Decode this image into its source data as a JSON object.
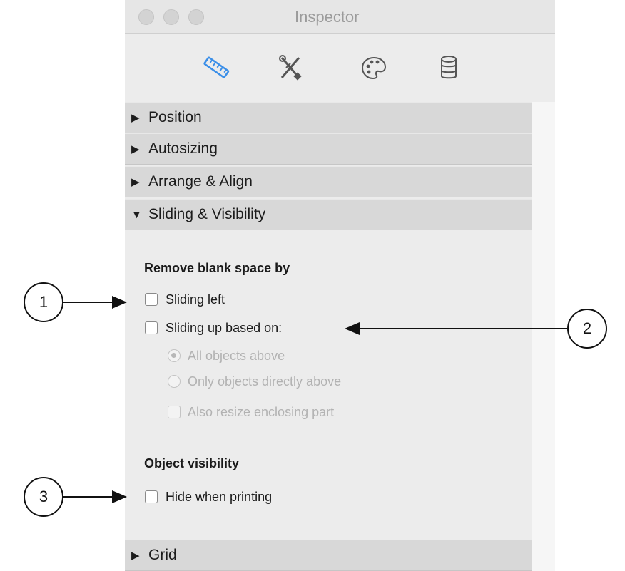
{
  "window": {
    "title": "Inspector"
  },
  "toolbar": {
    "tabs": [
      {
        "name": "position",
        "icon": "ruler-icon",
        "active": true
      },
      {
        "name": "styles",
        "icon": "tools-icon",
        "active": false
      },
      {
        "name": "appearance",
        "icon": "palette-icon",
        "active": false
      },
      {
        "name": "data",
        "icon": "database-icon",
        "active": false
      }
    ],
    "active_color": "#3b8fe8"
  },
  "sections": {
    "position": {
      "label": "Position",
      "expanded": false
    },
    "autosizing": {
      "label": "Autosizing",
      "expanded": false
    },
    "arrange": {
      "label": "Arrange & Align",
      "expanded": false
    },
    "sliding": {
      "label": "Sliding & Visibility",
      "expanded": true
    },
    "grid": {
      "label": "Grid",
      "expanded": false
    }
  },
  "sliding": {
    "remove_heading": "Remove blank space by",
    "sliding_left": {
      "label": "Sliding left",
      "checked": false
    },
    "sliding_up": {
      "label": "Sliding up based on:",
      "checked": false
    },
    "radio_all": {
      "label": "All objects above",
      "selected": true,
      "enabled": false
    },
    "radio_direct": {
      "label": "Only objects directly above",
      "selected": false,
      "enabled": false
    },
    "resize": {
      "label": "Also resize enclosing part",
      "checked": false,
      "enabled": false
    },
    "visibility_heading": "Object visibility",
    "hide_printing": {
      "label": "Hide when printing",
      "checked": false
    }
  },
  "callouts": [
    "1",
    "2",
    "3"
  ]
}
